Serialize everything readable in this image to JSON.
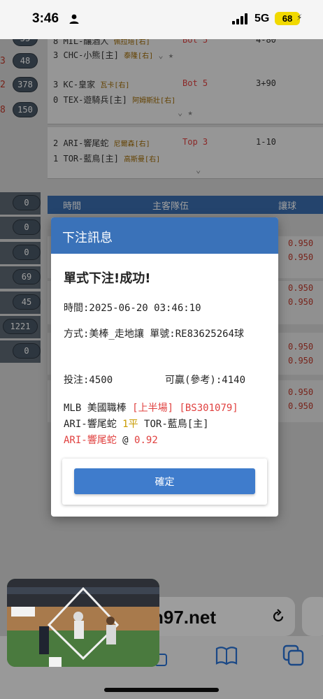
{
  "status_bar": {
    "time": "3:46",
    "network": "5G",
    "battery": "68"
  },
  "background": {
    "left_badges": [
      {
        "num": "",
        "count": "55"
      },
      {
        "num": "3",
        "count": "48"
      },
      {
        "num": "2",
        "count": "378"
      },
      {
        "num": "8",
        "count": "150"
      }
    ],
    "left_pills": [
      "0",
      "0",
      "0",
      "69",
      "45",
      "1221",
      "0"
    ],
    "games": [
      {
        "row1_num": "8",
        "row1_team": "MIL-釀酒人",
        "row1_pitcher": "佩拉塔[右]",
        "row1_status": "Bot 5",
        "row1_score": "4-80",
        "row2_num": "3",
        "row2_team": "CHC-小熊[主]",
        "row2_pitcher": "泰隆[右]"
      },
      {
        "row1_num": "3",
        "row1_team": "KC-皇家",
        "row1_pitcher": "瓦卡[右]",
        "row1_status": "Bot 5",
        "row1_score": "3+90",
        "row2_num": "0",
        "row2_team": "TEX-遊騎兵[主]",
        "row2_pitcher": "阿姆斯壯[右]"
      },
      {
        "row1_num": "2",
        "row1_team": "ARI-響尾蛇",
        "row1_pitcher": "尼爾森[右]",
        "row1_status": "Top 3",
        "row1_score": "1-10",
        "row2_num": "1",
        "row2_team": "TOR-藍鳥[主]",
        "row2_pitcher": "高斯曼[右]"
      }
    ],
    "table_headers": {
      "time": "時間",
      "teams": "主客隊伍",
      "handicap": "讓球"
    },
    "odds": [
      "0.950",
      "0.950",
      "0.950",
      "0.950",
      "0.950",
      "0.950",
      "0.950",
      "0.950"
    ]
  },
  "modal": {
    "title": "下注訊息",
    "headline": "單式下注!成功!",
    "time_line": "時間:2025-06-20 03:46:10",
    "method_line": "方式:美棒_走地讓 單號:RE83625264球",
    "stake_line": "投注:4500",
    "win_line": "可贏(參考):4140",
    "league": "MLB 美國職棒",
    "half": "[上半場]",
    "bet_code": "[BS301079]",
    "away_team": "ARI-響尾蛇",
    "handicap": "1平",
    "home_team": "TOR-藍鳥[主]",
    "pick": "ARI-響尾蛇",
    "at": "@",
    "odds": "0.92",
    "confirm_label": "確定"
  },
  "browser": {
    "url_text": "n97.net"
  },
  "colors": {
    "header_blue": "#3a72b9",
    "button_blue": "#3f7ccc",
    "accent_red": "#e0403f",
    "handicap_gold": "#c89a00"
  }
}
